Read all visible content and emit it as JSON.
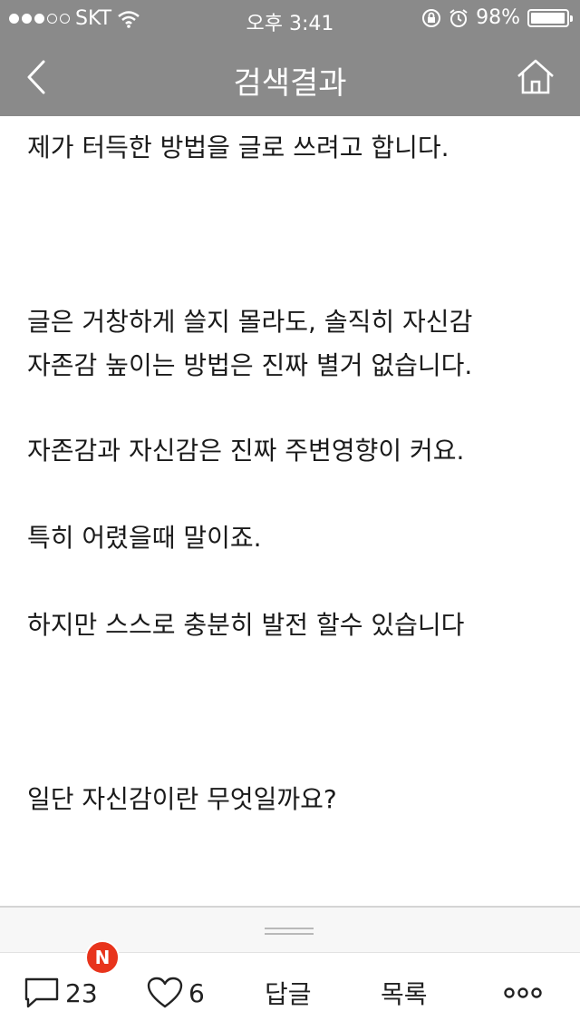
{
  "status_bar": {
    "carrier": "SKT",
    "time": "오후 3:41",
    "battery": "98%",
    "battery_level": 0.98,
    "signal_bars_filled": 3,
    "signal_bars_total": 5
  },
  "nav": {
    "title": "검색결과"
  },
  "article": {
    "paragraphs": [
      "제가 터득한 방법을 글로 쓰려고 합니다.",
      "글은 거창하게 쓸지 몰라도, 솔직히 자신감",
      "자존감 높이는 방법은 진짜 별거 없습니다.",
      "자존감과 자신감은 진짜 주변영향이 커요.",
      "특히 어렸을때 말이죠.",
      "하지만 스스로 충분히 발전 할수 있습니다",
      "일단 자신감이란 무엇일까요?"
    ]
  },
  "toolbar": {
    "comment_count": "23",
    "like_count": "6",
    "reply_label": "답글",
    "list_label": "목록",
    "new_badge": "N"
  },
  "colors": {
    "header_bg": "#8a8a8a",
    "badge": "#e8341c"
  }
}
